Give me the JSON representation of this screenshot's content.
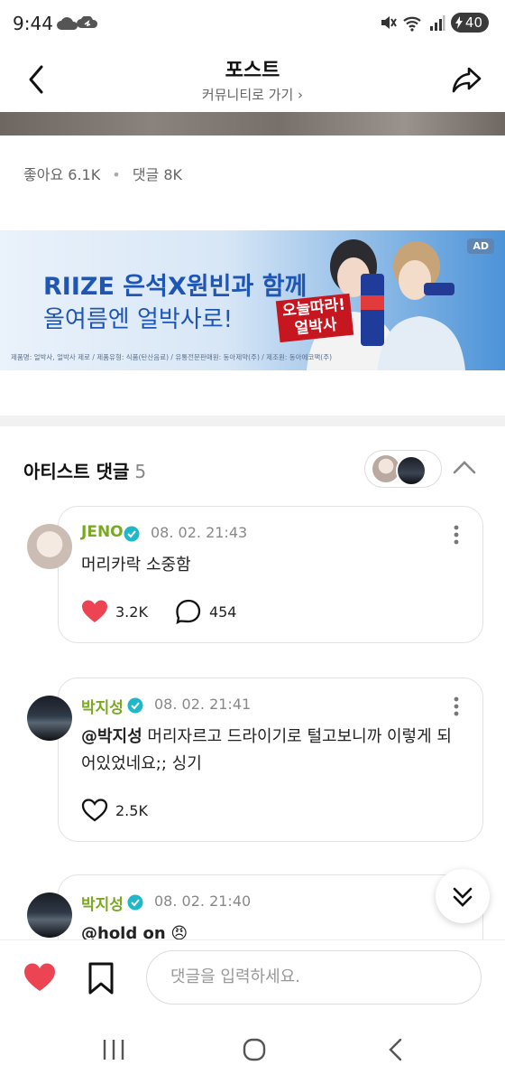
{
  "status_bar": {
    "time": "9:44",
    "battery": "40"
  },
  "header": {
    "title": "포스트",
    "community_link": "커뮤니티로 가기 ›"
  },
  "post_stats": {
    "likes_label": "좋아요",
    "likes": "6.1K",
    "comments_label": "댓글",
    "comments": "8K"
  },
  "ad": {
    "headline1": "RIIZE 은석X원빈과 함께",
    "headline2": "올여름엔 얼박사로!",
    "fine_print": "제품명: 얼박사, 얼박사 제로 / 제품유형: 식품(탄산음료) / 유통전문판매원: 동아제약(주) / 제조원: 동아에코팩(주)",
    "badge": "AD",
    "logo_line1": "오늘따라!",
    "logo_line2": "얼박사"
  },
  "artist_comments": {
    "title": "아티스트 댓글",
    "count": "5",
    "items": [
      {
        "author": "JENO",
        "time": "08. 02. 21:43",
        "text": "머리카락 소중함",
        "likes": "3.2K",
        "replies": "454",
        "liked": true
      },
      {
        "author": "박지성",
        "time": "08. 02. 21:41",
        "mention": "@박지성",
        "text": " 머리자르고 드라이기로 털고보니까 이렇게 되어있었네요;; 싱기",
        "likes": "2.5K",
        "liked": false
      },
      {
        "author": "박지성",
        "time": "08. 02. 21:40",
        "mention": "@hold on",
        "emoji": "😠"
      }
    ]
  },
  "input": {
    "placeholder": "댓글을 입력하세요."
  },
  "colors": {
    "author_green": "#7ba722",
    "like_red": "#ec4452",
    "verified": "#1fb8c9"
  }
}
